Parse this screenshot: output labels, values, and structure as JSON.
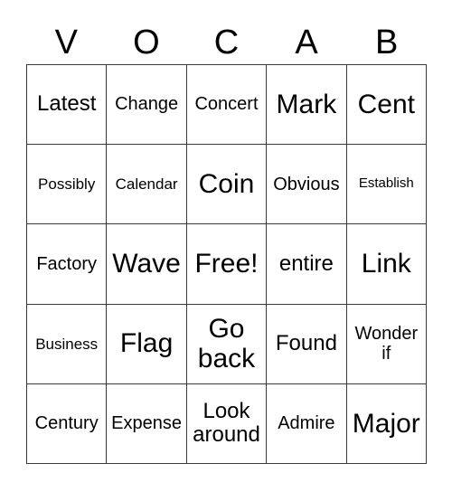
{
  "card": {
    "title_letters": [
      "V",
      "O",
      "C",
      "A",
      "B"
    ],
    "free_space_label": "Free!",
    "grid": [
      [
        {
          "text": "Latest",
          "size": "fs-l"
        },
        {
          "text": "Change",
          "size": "fs-m"
        },
        {
          "text": "Concert",
          "size": "fs-m"
        },
        {
          "text": "Mark",
          "size": "fs-xl"
        },
        {
          "text": "Cent",
          "size": "fs-xl"
        }
      ],
      [
        {
          "text": "Possibly",
          "size": "fs-s"
        },
        {
          "text": "Calendar",
          "size": "fs-s"
        },
        {
          "text": "Coin",
          "size": "fs-xl"
        },
        {
          "text": "Obvious",
          "size": "fs-m"
        },
        {
          "text": "Establish",
          "size": "fs-xs"
        }
      ],
      [
        {
          "text": "Factory",
          "size": "fs-m"
        },
        {
          "text": "Wave",
          "size": "fs-xl"
        },
        {
          "text": "Free!",
          "size": "fs-xl"
        },
        {
          "text": "entire",
          "size": "fs-l"
        },
        {
          "text": "Link",
          "size": "fs-xl"
        }
      ],
      [
        {
          "text": "Business",
          "size": "fs-s"
        },
        {
          "text": "Flag",
          "size": "fs-xl"
        },
        {
          "text": "Go back",
          "size": "fs-xl"
        },
        {
          "text": "Found",
          "size": "fs-l"
        },
        {
          "text": "Wonder if",
          "size": "fs-m"
        }
      ],
      [
        {
          "text": "Century",
          "size": "fs-m"
        },
        {
          "text": "Expense",
          "size": "fs-m"
        },
        {
          "text": "Look around",
          "size": "fs-l"
        },
        {
          "text": "Admire",
          "size": "fs-m"
        },
        {
          "text": "Major",
          "size": "fs-xl"
        }
      ]
    ],
    "colors": {
      "text": "#000000",
      "grid_line": "#3a3a3a",
      "background": "#ffffff"
    }
  }
}
